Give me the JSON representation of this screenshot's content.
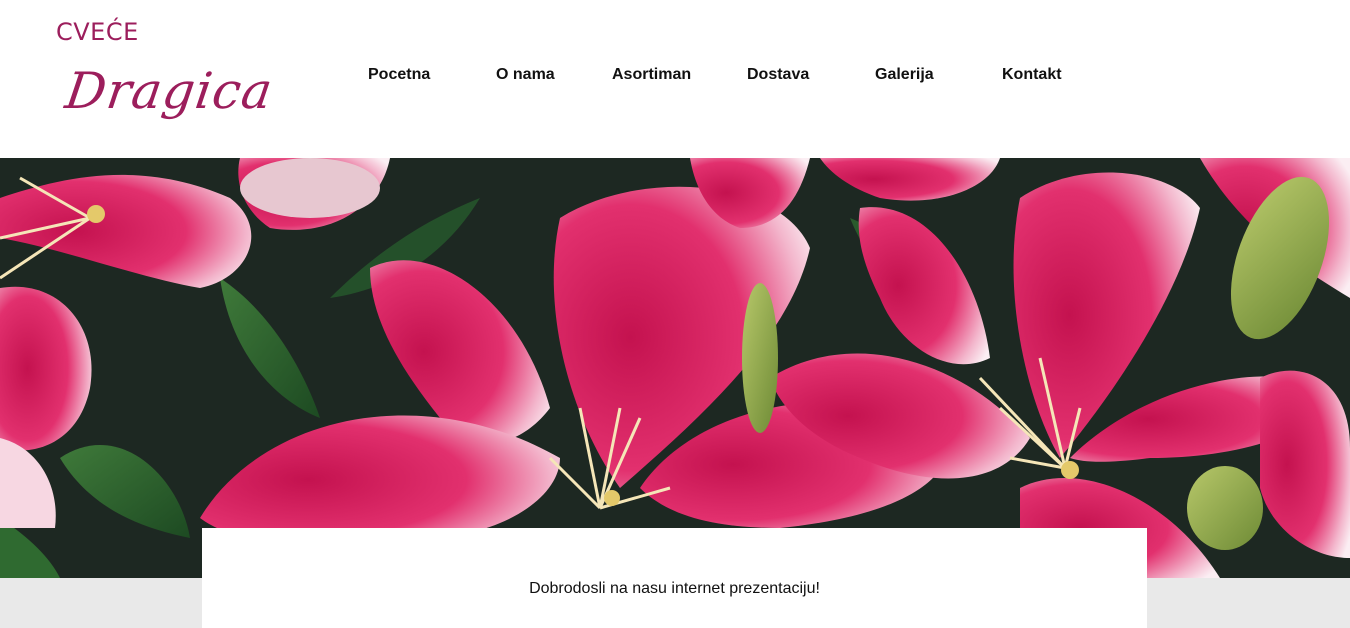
{
  "logo": {
    "top_text": "CVEĆE",
    "script_text": "Dragica"
  },
  "nav": {
    "items": [
      {
        "label": "Pocetna"
      },
      {
        "label": "O nama"
      },
      {
        "label": "Asortiman"
      },
      {
        "label": "Dostava"
      },
      {
        "label": "Galerija"
      },
      {
        "label": "Kontakt"
      }
    ]
  },
  "hero": {
    "image": "pink-lily-flowers-photo"
  },
  "content": {
    "welcome": "Dobrodosli na nasu internet prezentaciju!"
  },
  "colors": {
    "brand": "#9c1e5c",
    "nav_text": "#111111",
    "page_background": "#e9e9e9",
    "card_background": "#ffffff"
  }
}
